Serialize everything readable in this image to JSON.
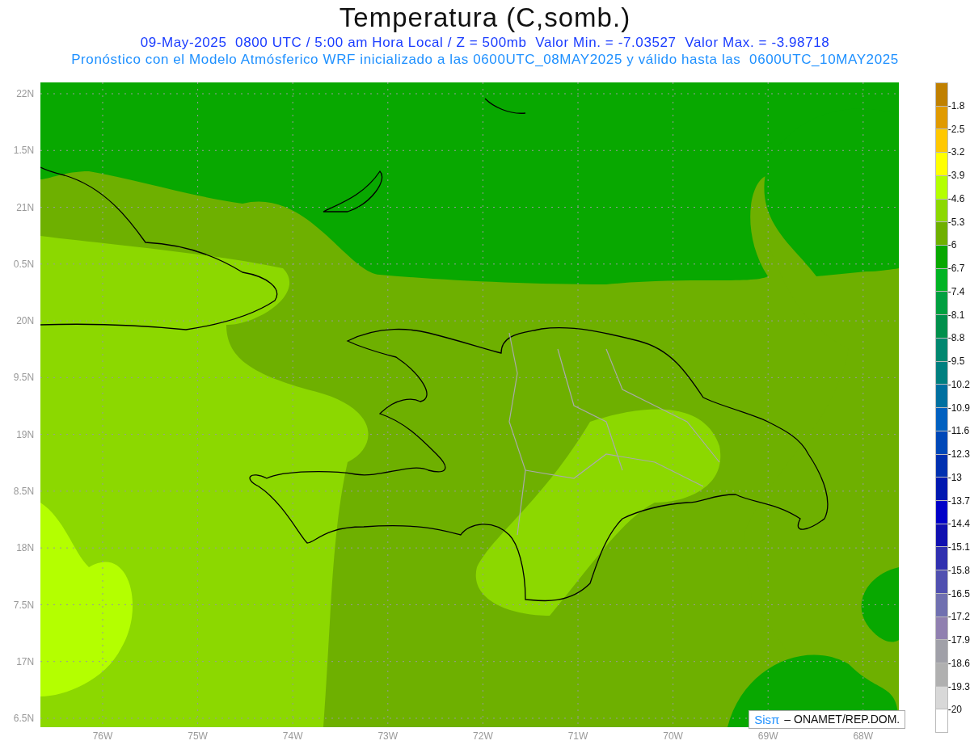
{
  "title": "Temperatura (C,somb.)",
  "subtitle": "09-May-2025  0800 UTC / 5:00 am Hora Local / Z = 500mb  Valor Min. = -7.03527  Valor Max. = -3.98718",
  "forecast_note": "Pronóstico con el Modelo Atmósferico WRF inicializado a las 0600UTC_08MAY2025 y válido hasta las  0600UTC_10MAY2025",
  "map": {
    "lat_labels": [
      "22N",
      "1.5N",
      "21N",
      "0.5N",
      "20N",
      "9.5N",
      "19N",
      "8.5N",
      "18N",
      "7.5N",
      "17N",
      "6.5N"
    ],
    "lon_labels": [
      "76W",
      "75W",
      "74W",
      "73W",
      "72W",
      "71W",
      "70W",
      "69W",
      "68W"
    ],
    "credit": {
      "brand": "Sisπ",
      "text": "– ONAMET/REP.DOM."
    }
  },
  "colorbar": {
    "segments": [
      {
        "color": "#c08000"
      },
      {
        "color": "#e09a00"
      },
      {
        "color": "#ffc800"
      },
      {
        "color": "#ffff00"
      },
      {
        "color": "#b4ff00"
      },
      {
        "color": "#8cd800"
      },
      {
        "color": "#6eb000"
      },
      {
        "color": "#08a800"
      },
      {
        "color": "#00b424"
      },
      {
        "color": "#00a040"
      },
      {
        "color": "#00904c"
      },
      {
        "color": "#008870"
      },
      {
        "color": "#008080"
      },
      {
        "color": "#0070a0"
      },
      {
        "color": "#0060c0"
      },
      {
        "color": "#0048b8"
      },
      {
        "color": "#0030b0"
      },
      {
        "color": "#0018b0"
      },
      {
        "color": "#0000c8"
      },
      {
        "color": "#1010b0"
      },
      {
        "color": "#3030b0"
      },
      {
        "color": "#5050b0"
      },
      {
        "color": "#7070b0"
      },
      {
        "color": "#9080b0"
      },
      {
        "color": "#a0a0a8"
      },
      {
        "color": "#b0b0b0"
      },
      {
        "color": "#d8d8d8"
      },
      {
        "color": "#ffffff"
      }
    ],
    "labels": [
      "-1.8",
      "-2.5",
      "-3.2",
      "-3.9",
      "-4.6",
      "-5.3",
      "-6",
      "-6.7",
      "-7.4",
      "-8.1",
      "-8.8",
      "-9.5",
      "-10.2",
      "-10.9",
      "-11.6",
      "-12.3",
      "-13",
      "-13.7",
      "-14.4",
      "-15.1",
      "-15.8",
      "-16.5",
      "-17.2",
      "-17.9",
      "-18.6",
      "-19.3",
      "-20"
    ]
  }
}
